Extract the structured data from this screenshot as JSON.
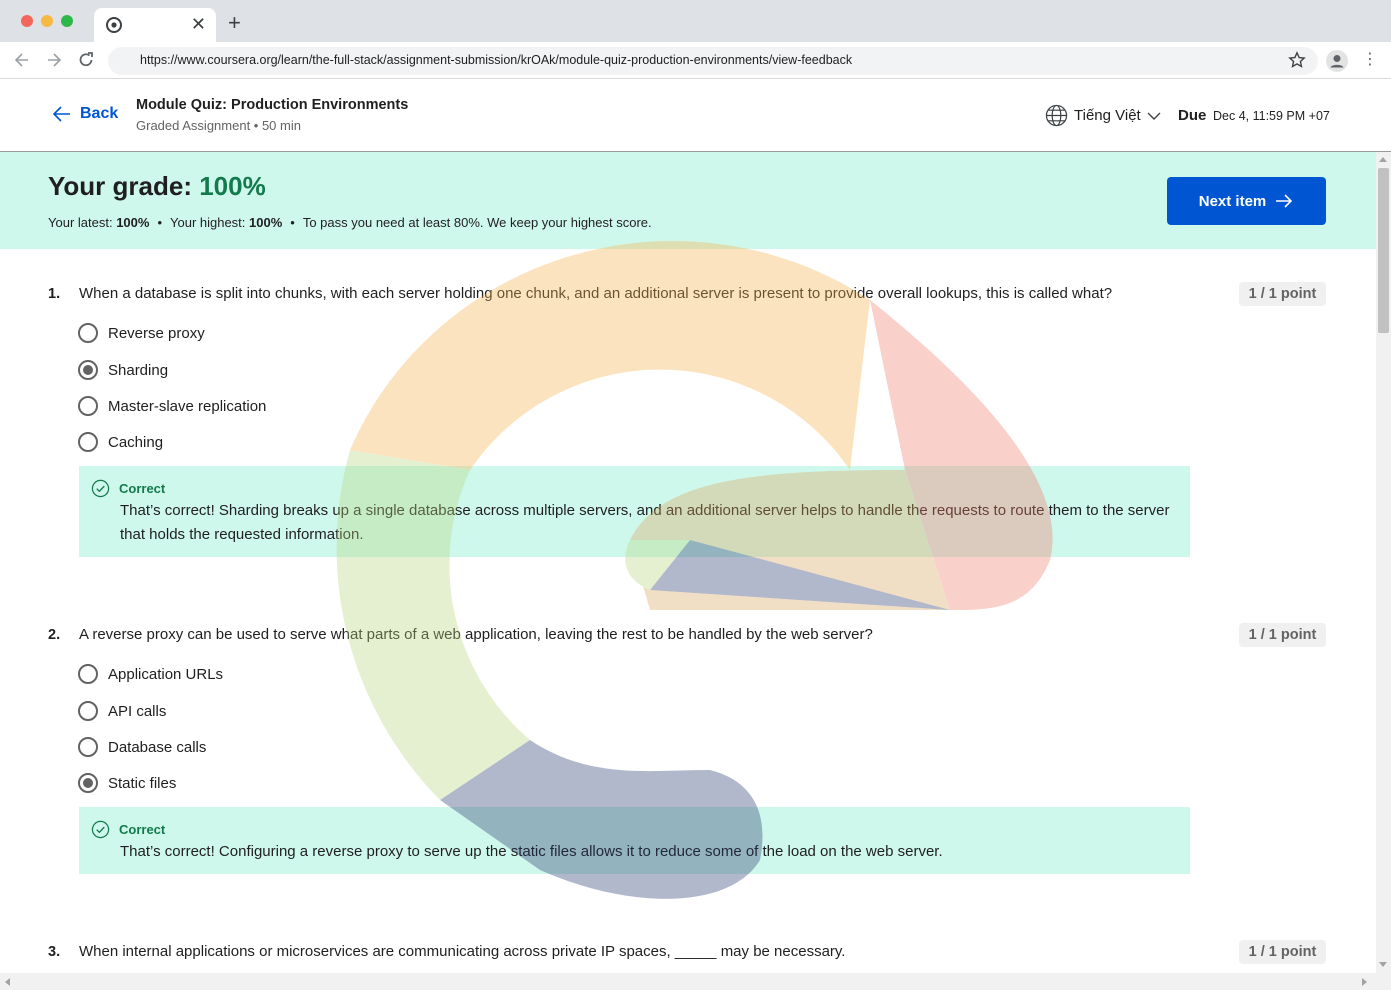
{
  "browser": {
    "url": "https://www.coursera.org/learn/the-full-stack/assignment-submission/krOAk/module-quiz-production-environments/view-feedback",
    "tab_close": "✕",
    "new_tab": "+",
    "menu": "⋮"
  },
  "header": {
    "back_label": "Back",
    "title": "Module Quiz: Production Environments",
    "subtitle": "Graded Assignment • 50 min",
    "language": "Tiếng Việt",
    "due_label": "Due",
    "due_value": "Dec 4, 11:59 PM +07"
  },
  "grade": {
    "label": "Your grade: ",
    "value": "100%",
    "latest_label": "Your latest: ",
    "latest_value": "100%",
    "highest_label": "Your highest: ",
    "highest_value": "100%",
    "pass_note": "To pass you need at least 80%. We keep your highest score.",
    "separator": "•",
    "next_button": "Next item"
  },
  "questions": [
    {
      "number": "1.",
      "text": "When a database is split into chunks, with each server holding one chunk, and an additional server is present to provide overall lookups, this is called what?",
      "points": "1 / 1 point",
      "options": [
        {
          "label": "Reverse proxy",
          "selected": false
        },
        {
          "label": "Sharding",
          "selected": true
        },
        {
          "label": "Master-slave replication",
          "selected": false
        },
        {
          "label": "Caching",
          "selected": false
        }
      ],
      "feedback_title": "Correct",
      "feedback_text": "That’s correct! Sharding breaks up a single database across multiple servers, and an additional server helps to handle the requests to route them to the server that holds the requested information."
    },
    {
      "number": "2.",
      "text": "A reverse proxy can be used to serve what parts of a web application, leaving the rest to be handled by the web server?",
      "points": "1 / 1 point",
      "options": [
        {
          "label": "Application URLs",
          "selected": false
        },
        {
          "label": "API calls",
          "selected": false
        },
        {
          "label": "Database calls",
          "selected": false
        },
        {
          "label": "Static files",
          "selected": true
        }
      ],
      "feedback_title": "Correct",
      "feedback_text": "That’s correct! Configuring a reverse proxy to serve up the static files allows it to reduce some of the load on the web server."
    },
    {
      "number": "3.",
      "text": "When internal applications or microservices are communicating across private IP spaces, _____ may be necessary.",
      "points": "1 / 1 point"
    }
  ],
  "colors": {
    "brand_blue": "#0056d2",
    "success_green": "#137a4e",
    "banner_bg": "#cff8ec"
  }
}
